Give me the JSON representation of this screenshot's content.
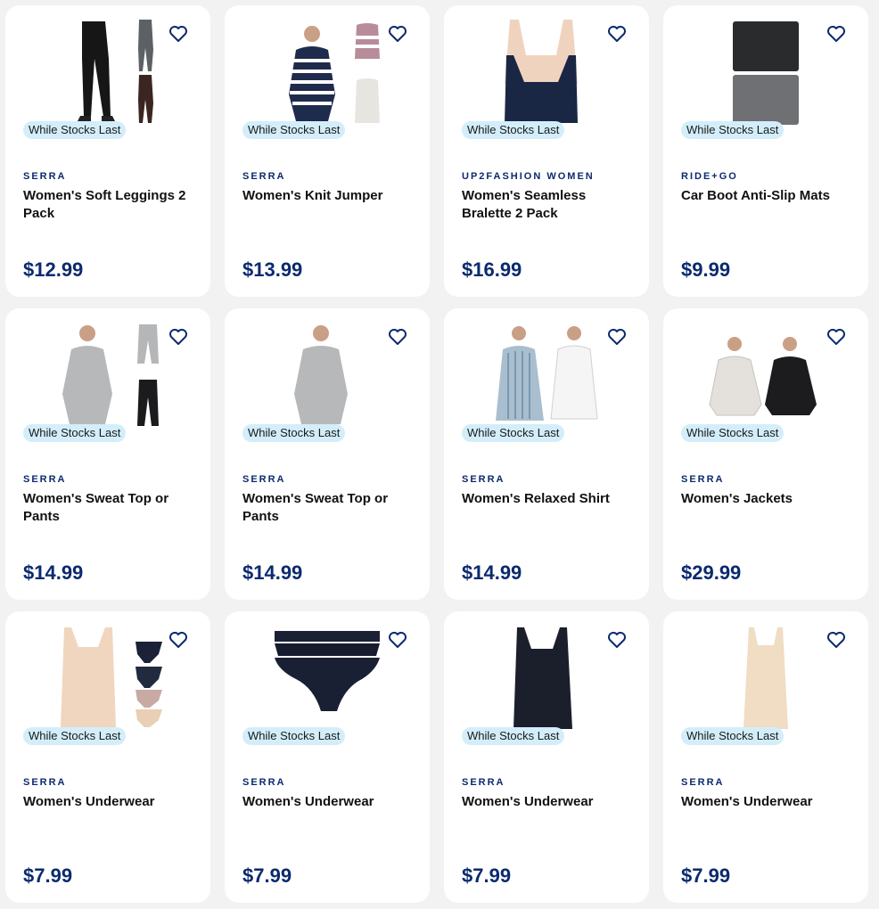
{
  "colors": {
    "brand_navy": "#0b2a6f",
    "badge_bg": "#d3eefa",
    "card_bg": "#ffffff",
    "page_bg": "#f2f2f2"
  },
  "products": [
    {
      "brand": "SERRA",
      "name": "Women's Soft Leggings 2 Pack",
      "price": "$12.99",
      "badge": "While Stocks Last",
      "image": "leggings"
    },
    {
      "brand": "SERRA",
      "name": "Women's Knit Jumper",
      "price": "$13.99",
      "badge": "While Stocks Last",
      "image": "jumper"
    },
    {
      "brand": "UP2FASHION WOMEN",
      "name": "Women's Seamless Bralette 2 Pack",
      "price": "$16.99",
      "badge": "While Stocks Last",
      "image": "bralette"
    },
    {
      "brand": "RIDE+GO",
      "name": "Car Boot Anti-Slip Mats",
      "price": "$9.99",
      "badge": "While Stocks Last",
      "image": "mats"
    },
    {
      "brand": "SERRA",
      "name": "Women's Sweat Top or Pants",
      "price": "$14.99",
      "badge": "While Stocks Last",
      "image": "sweat-set"
    },
    {
      "brand": "SERRA",
      "name": "Women's Sweat Top or Pants",
      "price": "$14.99",
      "badge": "While Stocks Last",
      "image": "sweat-top"
    },
    {
      "brand": "SERRA",
      "name": "Women's Relaxed Shirt",
      "price": "$14.99",
      "badge": "While Stocks Last",
      "image": "shirts"
    },
    {
      "brand": "SERRA",
      "name": "Women's Jackets",
      "price": "$29.99",
      "badge": "While Stocks Last",
      "image": "jackets"
    },
    {
      "brand": "SERRA",
      "name": "Women's Underwear",
      "price": "$7.99",
      "badge": "While Stocks Last",
      "image": "underwear-set"
    },
    {
      "brand": "SERRA",
      "name": "Women's Underwear",
      "price": "$7.99",
      "badge": "While Stocks Last",
      "image": "briefs"
    },
    {
      "brand": "SERRA",
      "name": "Women's Underwear",
      "price": "$7.99",
      "badge": "While Stocks Last",
      "image": "black-singlet"
    },
    {
      "brand": "SERRA",
      "name": "Women's Underwear",
      "price": "$7.99",
      "badge": "While Stocks Last",
      "image": "nude-singlet"
    }
  ]
}
